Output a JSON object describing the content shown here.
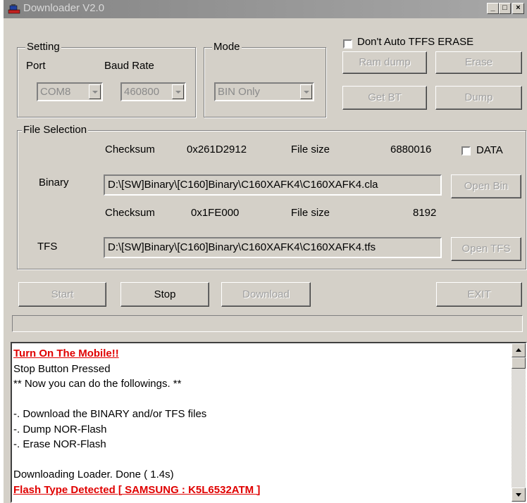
{
  "window": {
    "title": "Downloader V2.0",
    "minimize": "_",
    "maximize": "□",
    "close": "×"
  },
  "setting": {
    "group_label": "Setting",
    "port_label": "Port",
    "baud_label": "Baud Rate",
    "port_value": "COM8",
    "baud_value": "460800"
  },
  "mode": {
    "group_label": "Mode",
    "value": "BIN Only"
  },
  "top_right": {
    "no_auto_tffs_erase": "Don't Auto TFFS ERASE",
    "ram_dump": "Ram dump",
    "erase": "Erase",
    "get_bt": "Get BT",
    "dump": "Dump"
  },
  "file_selection": {
    "group_label": "File Selection",
    "binary": {
      "checksum_label": "Checksum",
      "checksum_value": "0x261D2912",
      "filesize_label": "File size",
      "filesize_value": "6880016",
      "data_checkbox_label": "DATA",
      "label": "Binary",
      "path": "D:\\[SW]Binary\\[C160]Binary\\C160XAFK4\\C160XAFK4.cla",
      "open_button": "Open Bin"
    },
    "tfs": {
      "checksum_label": "Checksum",
      "checksum_value": "0x1FE000",
      "filesize_label": "File size",
      "filesize_value": "8192",
      "label": "TFS",
      "path": "D:\\[SW]Binary\\[C160]Binary\\C160XAFK4\\C160XAFK4.tfs",
      "open_button": "Open TFS"
    }
  },
  "actions": {
    "start": "Start",
    "stop": "Stop",
    "download": "Download",
    "exit": "EXIT"
  },
  "progress": 0,
  "log": {
    "lines": [
      {
        "text": "Turn On The Mobile!!",
        "style": "red"
      },
      {
        "text": "Stop Button Pressed",
        "style": "normal"
      },
      {
        "text": "** Now you can do the followings. **",
        "style": "normal"
      },
      {
        "text": "",
        "style": "blank"
      },
      {
        "text": "-. Download the BINARY and/or TFS files",
        "style": "normal"
      },
      {
        "text": "-. Dump NOR-Flash",
        "style": "normal"
      },
      {
        "text": "-. Erase NOR-Flash",
        "style": "normal"
      },
      {
        "text": "",
        "style": "blank"
      },
      {
        "text": "Downloading Loader. Done (  1.4s)",
        "style": "normal"
      },
      {
        "text": "Flash Type Detected [ SAMSUNG : K5L6532ATM ]",
        "style": "red"
      }
    ]
  }
}
